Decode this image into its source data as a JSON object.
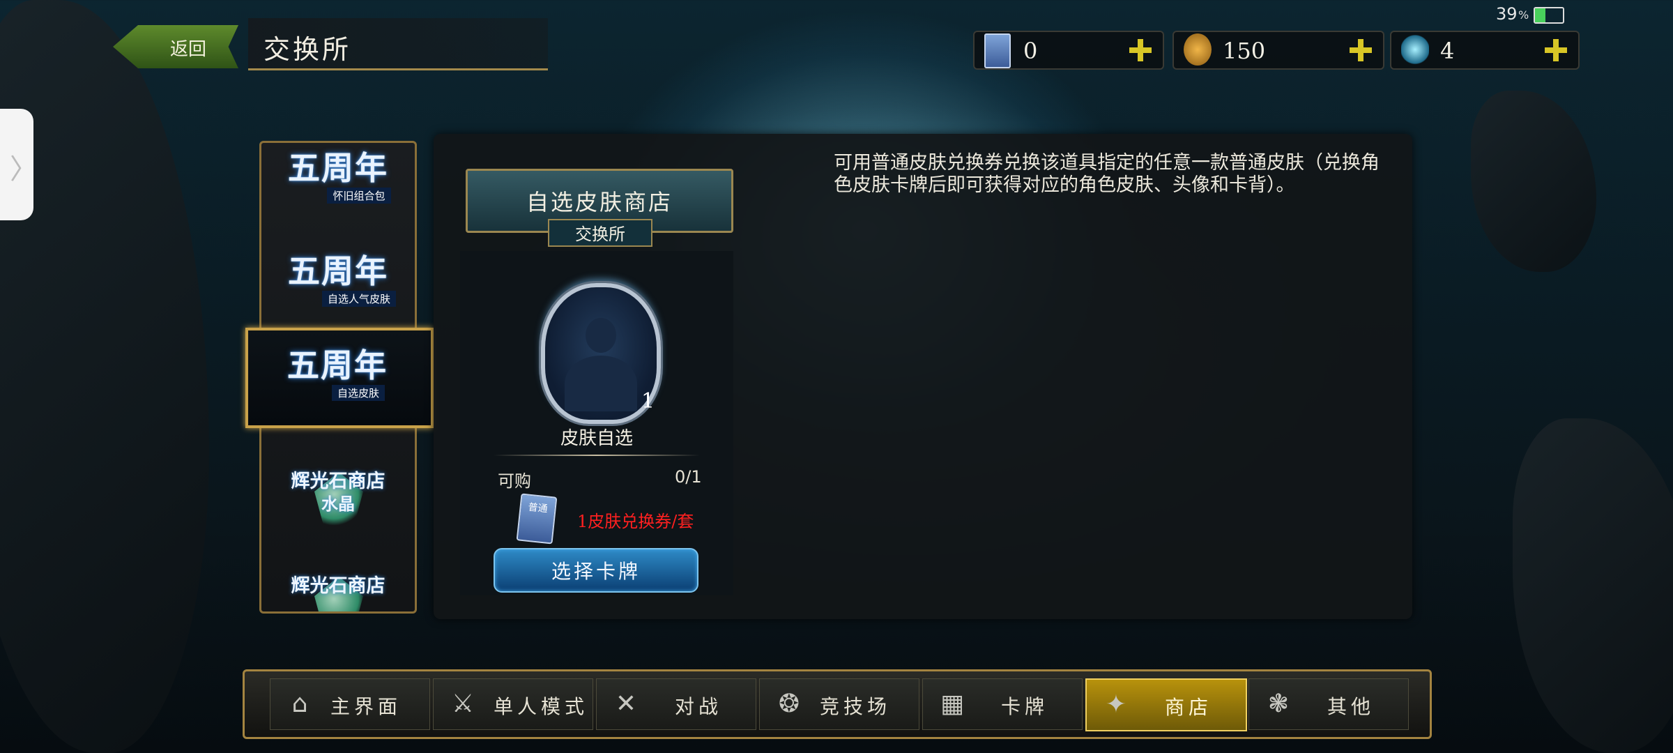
{
  "header": {
    "back_label": "返回",
    "title": "交换所"
  },
  "status": {
    "battery": "39"
  },
  "currencies": [
    {
      "icon": "skin-ticket-icon",
      "value": "0"
    },
    {
      "icon": "coin-bag-icon",
      "value": "150"
    },
    {
      "icon": "crystal-icon",
      "value": "4"
    }
  ],
  "categories": [
    {
      "title": "五周年",
      "subtitle": "怀旧组合包"
    },
    {
      "title": "五周年",
      "subtitle": "自选人气皮肤"
    },
    {
      "title": "五周年",
      "subtitle": "自选皮肤",
      "selected": true
    },
    {
      "title": "辉光石商店",
      "subtitle": "水晶"
    },
    {
      "title": "辉光石商店",
      "subtitle": ""
    }
  ],
  "shop": {
    "name": "自选皮肤商店",
    "sub": "交换所",
    "description": "可用普通皮肤兑换券兑换该道具指定的任意一款普通皮肤（兑换角色皮肤卡牌后即可获得对应的角色皮肤、头像和卡背）。"
  },
  "item": {
    "count": "1",
    "name": "皮肤自选",
    "buy_label": "可购",
    "buy_count": "0/1",
    "ticket_text": "普通",
    "cost": "1皮肤兑换券/套",
    "button": "选择卡牌"
  },
  "nav": [
    {
      "label": "主界面",
      "icon": "home-icon"
    },
    {
      "label": "单人模式",
      "icon": "sword-shield-icon"
    },
    {
      "label": "对战",
      "icon": "crossed-swords-icon"
    },
    {
      "label": "竞技场",
      "icon": "arena-icon"
    },
    {
      "label": "卡牌",
      "icon": "cards-icon"
    },
    {
      "label": "商店",
      "icon": "shop-icon",
      "active": true
    },
    {
      "label": "其他",
      "icon": "other-icon"
    }
  ],
  "colors": {
    "accent_gold": "#c9a24a",
    "cost_red": "#ff2020",
    "button_blue": "#2e8ac6"
  }
}
